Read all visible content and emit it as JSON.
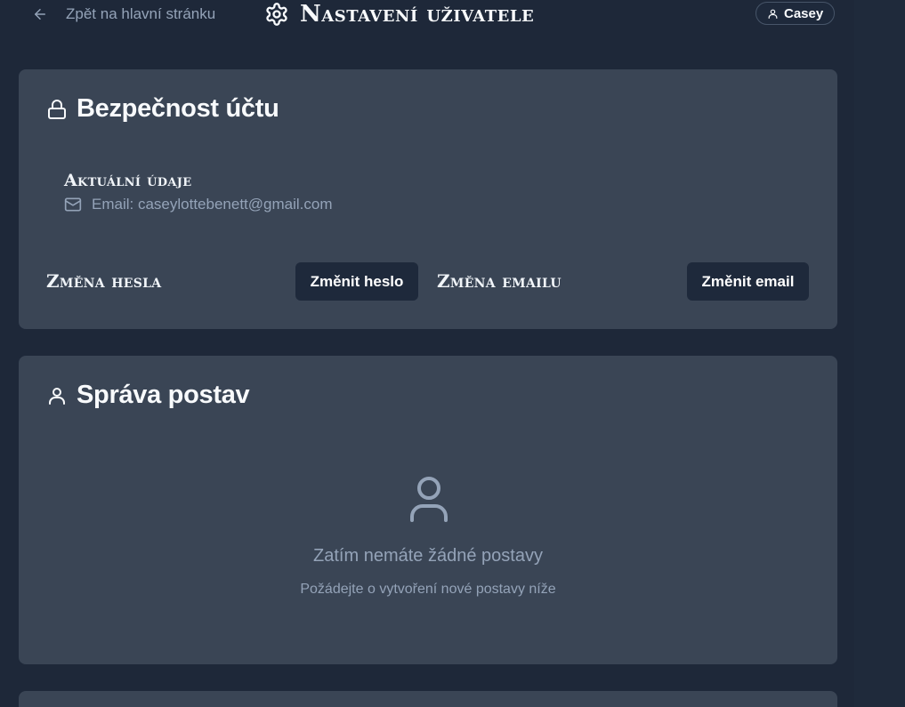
{
  "header": {
    "back_label": "Zpět na hlavní stránku",
    "title": "Nastavení uživatele",
    "user_name": "Casey"
  },
  "security": {
    "heading": "Bezpečnost účtu",
    "current_label": "Aktuální údaje",
    "email_text": "Email: caseylottebenett@gmail.com",
    "password_section_label": "Změna hesla",
    "password_button": "Změnit heslo",
    "email_section_label": "Změna emailu",
    "email_button": "Změnit email"
  },
  "characters": {
    "heading": "Správa postav",
    "empty_title": "Zatím nemáte žádné postavy",
    "empty_subtitle": "Požádejte o vytvoření nové postavy níže"
  },
  "colors": {
    "background": "#1e2839",
    "card": "#3a4555",
    "button": "#1e293b",
    "muted_text": "#94a3b8"
  },
  "icons": {
    "back": "arrow-left-icon",
    "title": "gear-icon",
    "user": "user-icon",
    "security": "lock-icon",
    "email": "mail-icon",
    "characters": "user-icon",
    "empty": "user-icon"
  }
}
